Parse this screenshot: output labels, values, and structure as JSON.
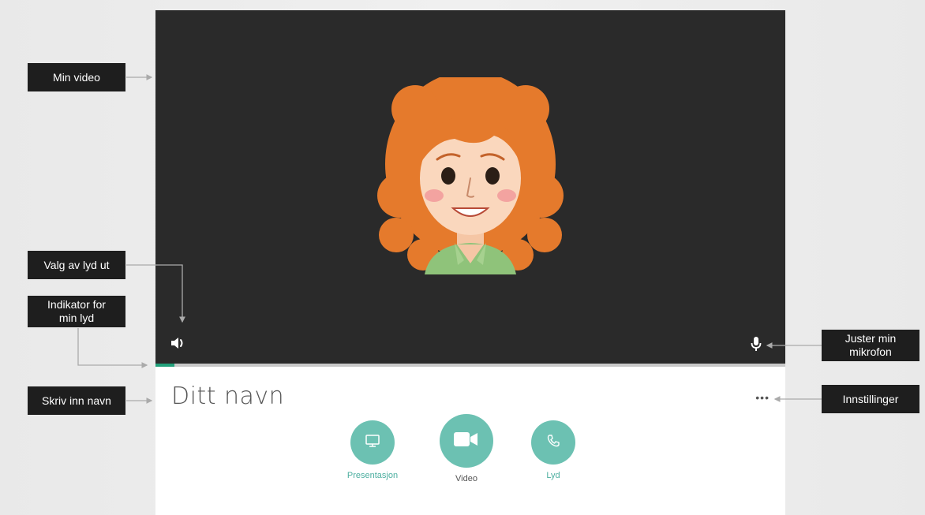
{
  "callouts": {
    "my_video": "Min video",
    "audio_out": "Valg av lyd ut",
    "audio_indicator": "Indikator for min lyd",
    "enter_name": "Skriv inn navn",
    "adjust_mic": "Juster min mikrofon",
    "settings": "Innstillinger"
  },
  "name_field": {
    "value": "Ditt navn"
  },
  "more_button": {
    "label": "•••"
  },
  "controls": {
    "presentation": "Presentasjon",
    "video": "Video",
    "audio": "Lyd"
  },
  "audio_level": 0.03,
  "colors": {
    "video_bg": "#2a2a2a",
    "accent": "#6cc1b2",
    "audio_level": "#21a07a",
    "callout_bg": "#1e1e1e"
  },
  "icons": {
    "speaker": "speaker-icon",
    "mic": "mic-icon",
    "presentation": "monitor-icon",
    "video": "video-camera-icon",
    "audio": "phone-icon"
  }
}
